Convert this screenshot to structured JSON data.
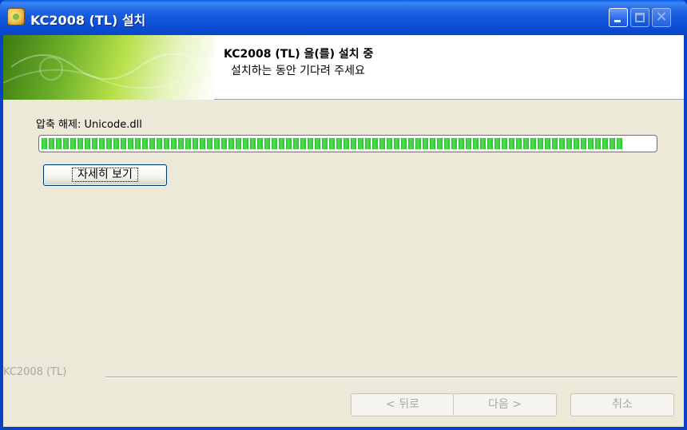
{
  "window": {
    "title": "KC2008 (TL) 설치",
    "controls": {
      "minimize": "minimize",
      "maximize": "maximize",
      "close": "✕"
    }
  },
  "banner": {
    "title": "KC2008 (TL) 을(를) 설치 중",
    "subtitle": "설치하는 동안 기다려 주세요"
  },
  "status": {
    "label": "압축 해제: Unicode.dll",
    "progress": 0.95
  },
  "details_button": {
    "label": "자세히 보기"
  },
  "footer": {
    "brand": "KC2008 (TL)",
    "back_label": "< 뒤로",
    "next_label": "다음 >",
    "cancel_label": "취소"
  },
  "colors": {
    "titlebar": "#0C4FD6",
    "progress_fill": "#2DC22D",
    "disabled_text": "#A8A8A0"
  },
  "icons": {
    "app": "installer-icon",
    "minimize": "minimize-icon",
    "maximize": "maximize-icon",
    "close": "close-icon"
  }
}
